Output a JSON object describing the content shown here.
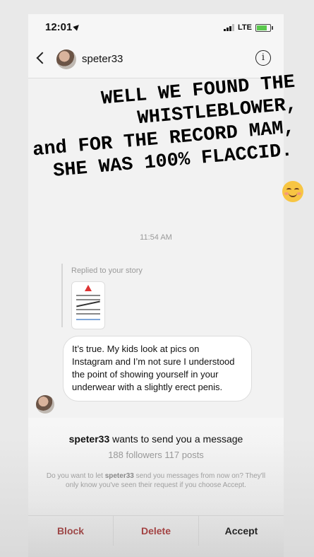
{
  "status_bar": {
    "time": "12:01",
    "network": "LTE"
  },
  "header": {
    "username": "speter33",
    "info_glyph": "i"
  },
  "overlay_text": {
    "lines": [
      "WELL WE FOUND THE",
      "WHISTLEBLOWER,",
      "and FOR THE RECORD MAM,",
      "SHE WAS 100% FLACCID."
    ]
  },
  "chat": {
    "timestamp": "11:54 AM",
    "reply_label": "Replied to your story",
    "message": "It’s true. My kids look at pics on Instagram and I’m not sure I understood the point of showing yourself in your underwear with a slightly erect penis."
  },
  "request": {
    "username": "speter33",
    "title_suffix": " wants to send you a message",
    "stats": "188 followers 117 posts",
    "desc_prefix": "Do you want to let ",
    "desc_user": "speter33",
    "desc_suffix": " send you messages from now on? They'll only know you've seen their request if you choose Accept.",
    "buttons": {
      "block": "Block",
      "delete": "Delete",
      "accept": "Accept"
    }
  },
  "icons": [
    "location-arrow-icon",
    "signal-icon",
    "battery-icon",
    "back-chevron-icon",
    "info-icon",
    "relieved-face-emoji-icon",
    "warning-icon"
  ]
}
